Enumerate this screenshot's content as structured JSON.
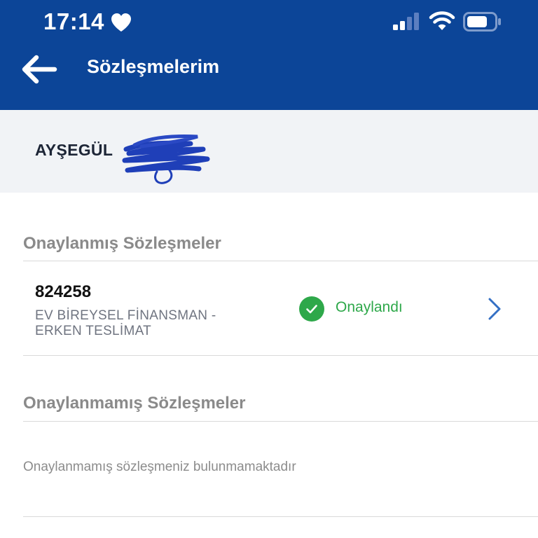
{
  "status_bar": {
    "time": "17:14",
    "icons": [
      "heart-icon",
      "cellular-signal-icon",
      "wifi-icon",
      "battery-icon"
    ]
  },
  "header": {
    "title": "Sözleşmelerim",
    "back_icon": "arrow-left-icon"
  },
  "user": {
    "name": "AYŞEGÜL"
  },
  "approved_section": {
    "title": "Onaylanmış Sözleşmeler",
    "items": [
      {
        "contract_number": "824258",
        "description_line1": "EV BİREYSEL FİNANSMAN -",
        "description_line2": "ERKEN TESLİMAT",
        "status": "Onaylandı",
        "status_icon": "check-circle-icon",
        "action_icon": "chevron-right-icon"
      }
    ]
  },
  "unapproved_section": {
    "title": "Onaylanmamış Sözleşmeler",
    "empty_message": "Onaylanmamış sözleşmeniz bulunmamaktadır"
  },
  "colors": {
    "header_bg": "#0c4598",
    "user_band_bg": "#f1f3f6",
    "status_green": "#2ea84a",
    "chevron_blue": "#3470c4",
    "section_title_gray": "#8a8a8a"
  }
}
